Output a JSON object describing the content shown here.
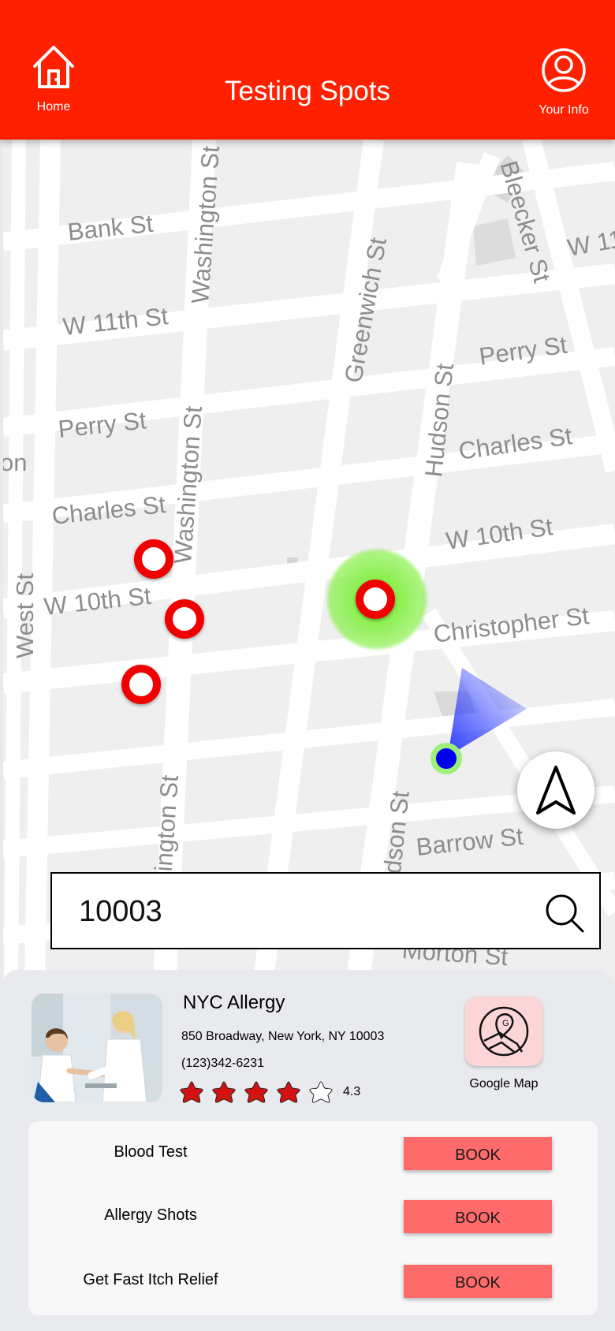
{
  "header": {
    "title": "Testing Spots",
    "home_label": "Home",
    "info_label": "Your Info",
    "color": "#ff2000"
  },
  "map": {
    "streets": [
      "Bank St",
      "W 11th St",
      "Perry St",
      "Charles St",
      "W 10th St",
      "Washington St",
      "Washington St",
      "ashington St",
      "Greenwich St",
      "Hudson St",
      "udson St",
      "Bleecker St",
      "W 11",
      "Perry St",
      "Charles St",
      "W 10th St",
      "Christopher St",
      "Barrow St",
      "Morton St",
      "on",
      "West St"
    ],
    "markers": [
      "testing-site",
      "testing-site",
      "testing-site",
      "testing-site-selected"
    ],
    "user_location_icon": "blue-dot-with-heading",
    "recenter_icon": "navigation-arrow-icon"
  },
  "search": {
    "value": "10003",
    "icon": "search-icon"
  },
  "clinic": {
    "name": "NYC Allergy",
    "address": "850 Broadway, New York, NY 10003",
    "phone": "(123)342-6231",
    "rating": "4.3",
    "stars_filled": 4,
    "stars_total": 5,
    "map_button_label": "Google Map",
    "map_icon": "map-pin-icon"
  },
  "services": [
    {
      "name": "Blood Test",
      "action": "BOOK"
    },
    {
      "name": "Allergy Shots",
      "action": "BOOK"
    },
    {
      "name": "Get Fast Itch Relief",
      "action": "BOOK"
    }
  ],
  "colors": {
    "accent": "#ff2000",
    "book_button": "#ff6b6b",
    "marker": "#f00000",
    "star": "#d31212"
  }
}
